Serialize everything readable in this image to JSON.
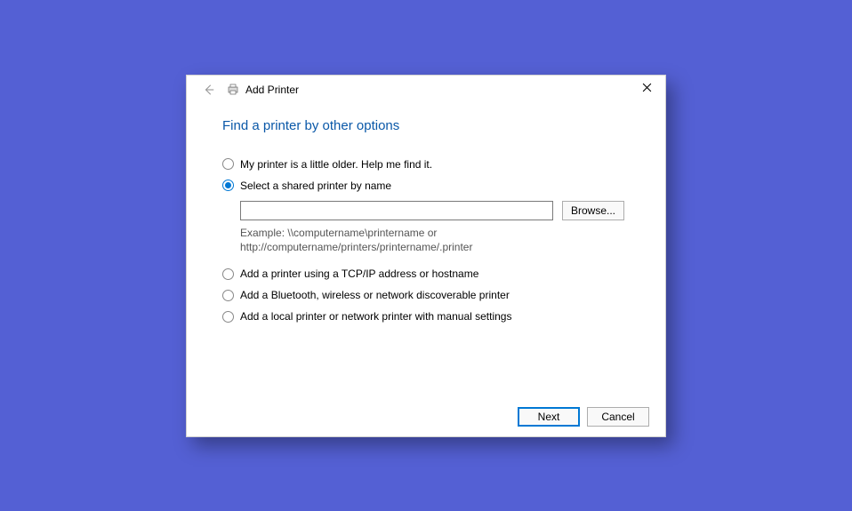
{
  "dialog": {
    "title": "Add Printer",
    "heading": "Find a printer by other options",
    "close_label": "Close"
  },
  "options": {
    "opt0": {
      "label": "My printer is a little older. Help me find it.",
      "selected": false
    },
    "opt1": {
      "label": "Select a shared printer by name",
      "selected": true
    },
    "opt2": {
      "label": "Add a printer using a TCP/IP address or hostname",
      "selected": false
    },
    "opt3": {
      "label": "Add a Bluetooth, wireless or network discoverable printer",
      "selected": false
    },
    "opt4": {
      "label": "Add a local printer or network printer with manual settings",
      "selected": false
    }
  },
  "shared": {
    "path_value": "",
    "browse_label": "Browse...",
    "example_text": "Example: \\\\computername\\printername or http://computername/printers/printername/.printer"
  },
  "footer": {
    "next_label": "Next",
    "cancel_label": "Cancel"
  }
}
